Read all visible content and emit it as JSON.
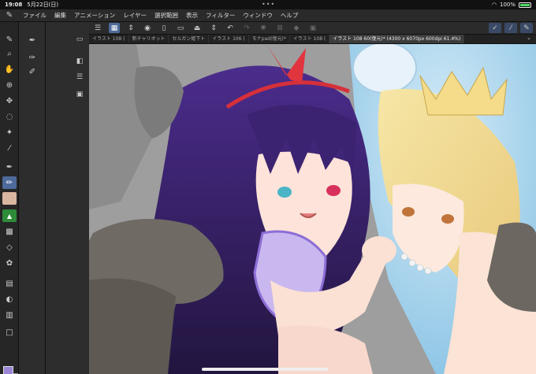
{
  "status": {
    "time": "19:08",
    "date": "5月22日(日)",
    "battery": "100%"
  },
  "menu": {
    "items": [
      "ファイル",
      "編集",
      "アニメーション",
      "レイヤー",
      "選択範囲",
      "表示",
      "フィルター",
      "ウィンドウ",
      "ヘルプ"
    ]
  },
  "tabs": {
    "items": [
      {
        "label": "イラスト 108 ("
      },
      {
        "label": "新チャリオット"
      },
      {
        "label": "セルガン姫下ト"
      },
      {
        "label": "イラスト 106 ("
      },
      {
        "label": "モナpad(復元)*"
      },
      {
        "label": "イラスト 108 ("
      },
      {
        "label": "イラスト 108 60(復元)* (4300 x 6070px 600dpi 61.4%)"
      }
    ]
  },
  "colors": {
    "main_color": "#9b86d6",
    "sub_color": "#ffffff",
    "accent": "#4d6a9a"
  },
  "icons": {
    "toolbar": [
      "menu-icon",
      "select-icon",
      "transform-icon",
      "view-icon",
      "new-icon",
      "open-icon",
      "save-icon",
      "undo-icon",
      "redo-icon",
      "loading-icon",
      "clear-icon",
      "fill-icon",
      "settings-icon"
    ]
  }
}
